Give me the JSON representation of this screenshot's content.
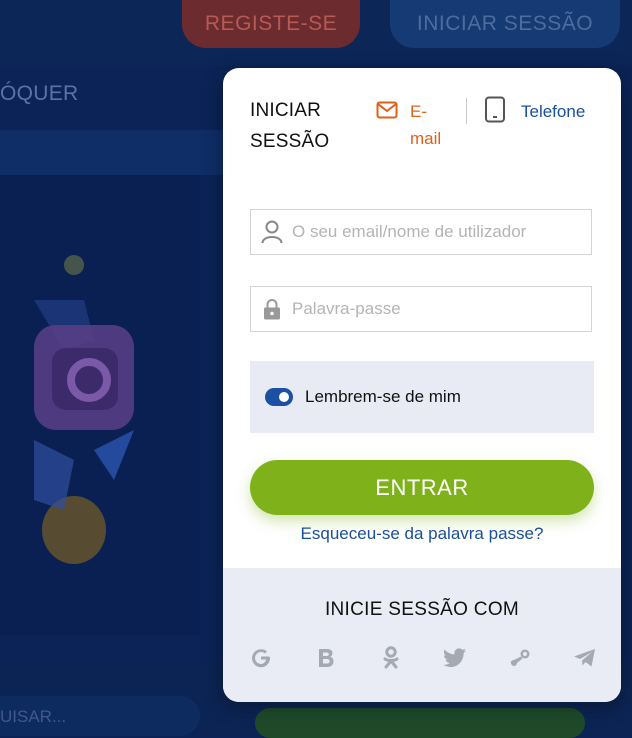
{
  "background": {
    "header": {
      "register_label": "REGISTE-SE",
      "login_label": "INICIAR SESSÃO"
    },
    "nav_label": "ÓQUER",
    "search_placeholder": "UISAR..."
  },
  "modal": {
    "title": "INICIAR SESSÃO",
    "tabs": [
      {
        "label": "E-mail",
        "icon": "mail-icon",
        "active": true
      },
      {
        "label": "Telefone",
        "icon": "phone-icon",
        "active": false
      }
    ],
    "email_placeholder": "O seu email/nome de utilizador",
    "email_value": "",
    "password_placeholder": "Palavra-passe",
    "password_value": "",
    "remember_label": "Lembrem-se de mim",
    "remember_checked": true,
    "submit_label": "ENTRAR",
    "forgot_label": "Esqueceu-se da palavra passe?",
    "social_title": "INICIE SESSÃO COM",
    "social_icons": [
      "google-icon",
      "vk-icon",
      "odnoklassniki-icon",
      "twitter-icon",
      "steam-icon",
      "telegram-icon"
    ]
  },
  "colors": {
    "accent_orange": "#e06019",
    "link_blue": "#1a4f9a",
    "button_green": "#7fb21a",
    "background_navy": "#0b2356"
  }
}
